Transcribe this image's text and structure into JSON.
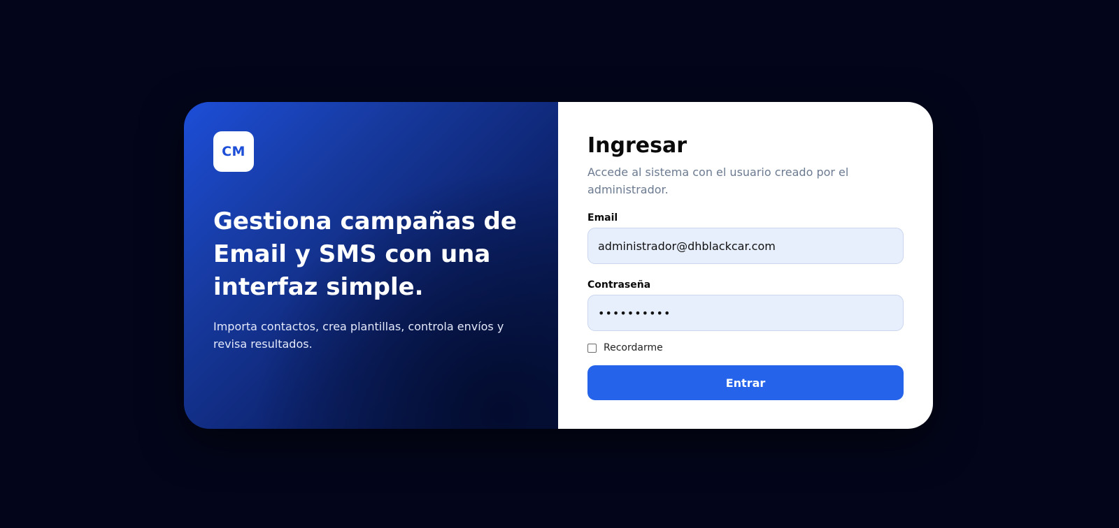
{
  "hero": {
    "logo_text": "CM",
    "title": "Gestiona campañas de Email y SMS con una interfaz simple.",
    "subtitle": "Importa contactos, crea plantillas, controla envíos y revisa resultados."
  },
  "login": {
    "title": "Ingresar",
    "subtitle": "Accede al sistema con el usuario creado por el administrador.",
    "email_label": "Email",
    "email_value": "administrador@dhblackcar.com",
    "password_label": "Contraseña",
    "password_value": "••••••••••",
    "remember_label": "Recordarme",
    "remember_checked": false,
    "submit_label": "Entrar"
  },
  "colors": {
    "background": "#03061a",
    "accent": "#2563eb",
    "hero_gradient_start": "#1d4ed8",
    "hero_gradient_end": "#061546",
    "input_background": "#e8effc"
  }
}
